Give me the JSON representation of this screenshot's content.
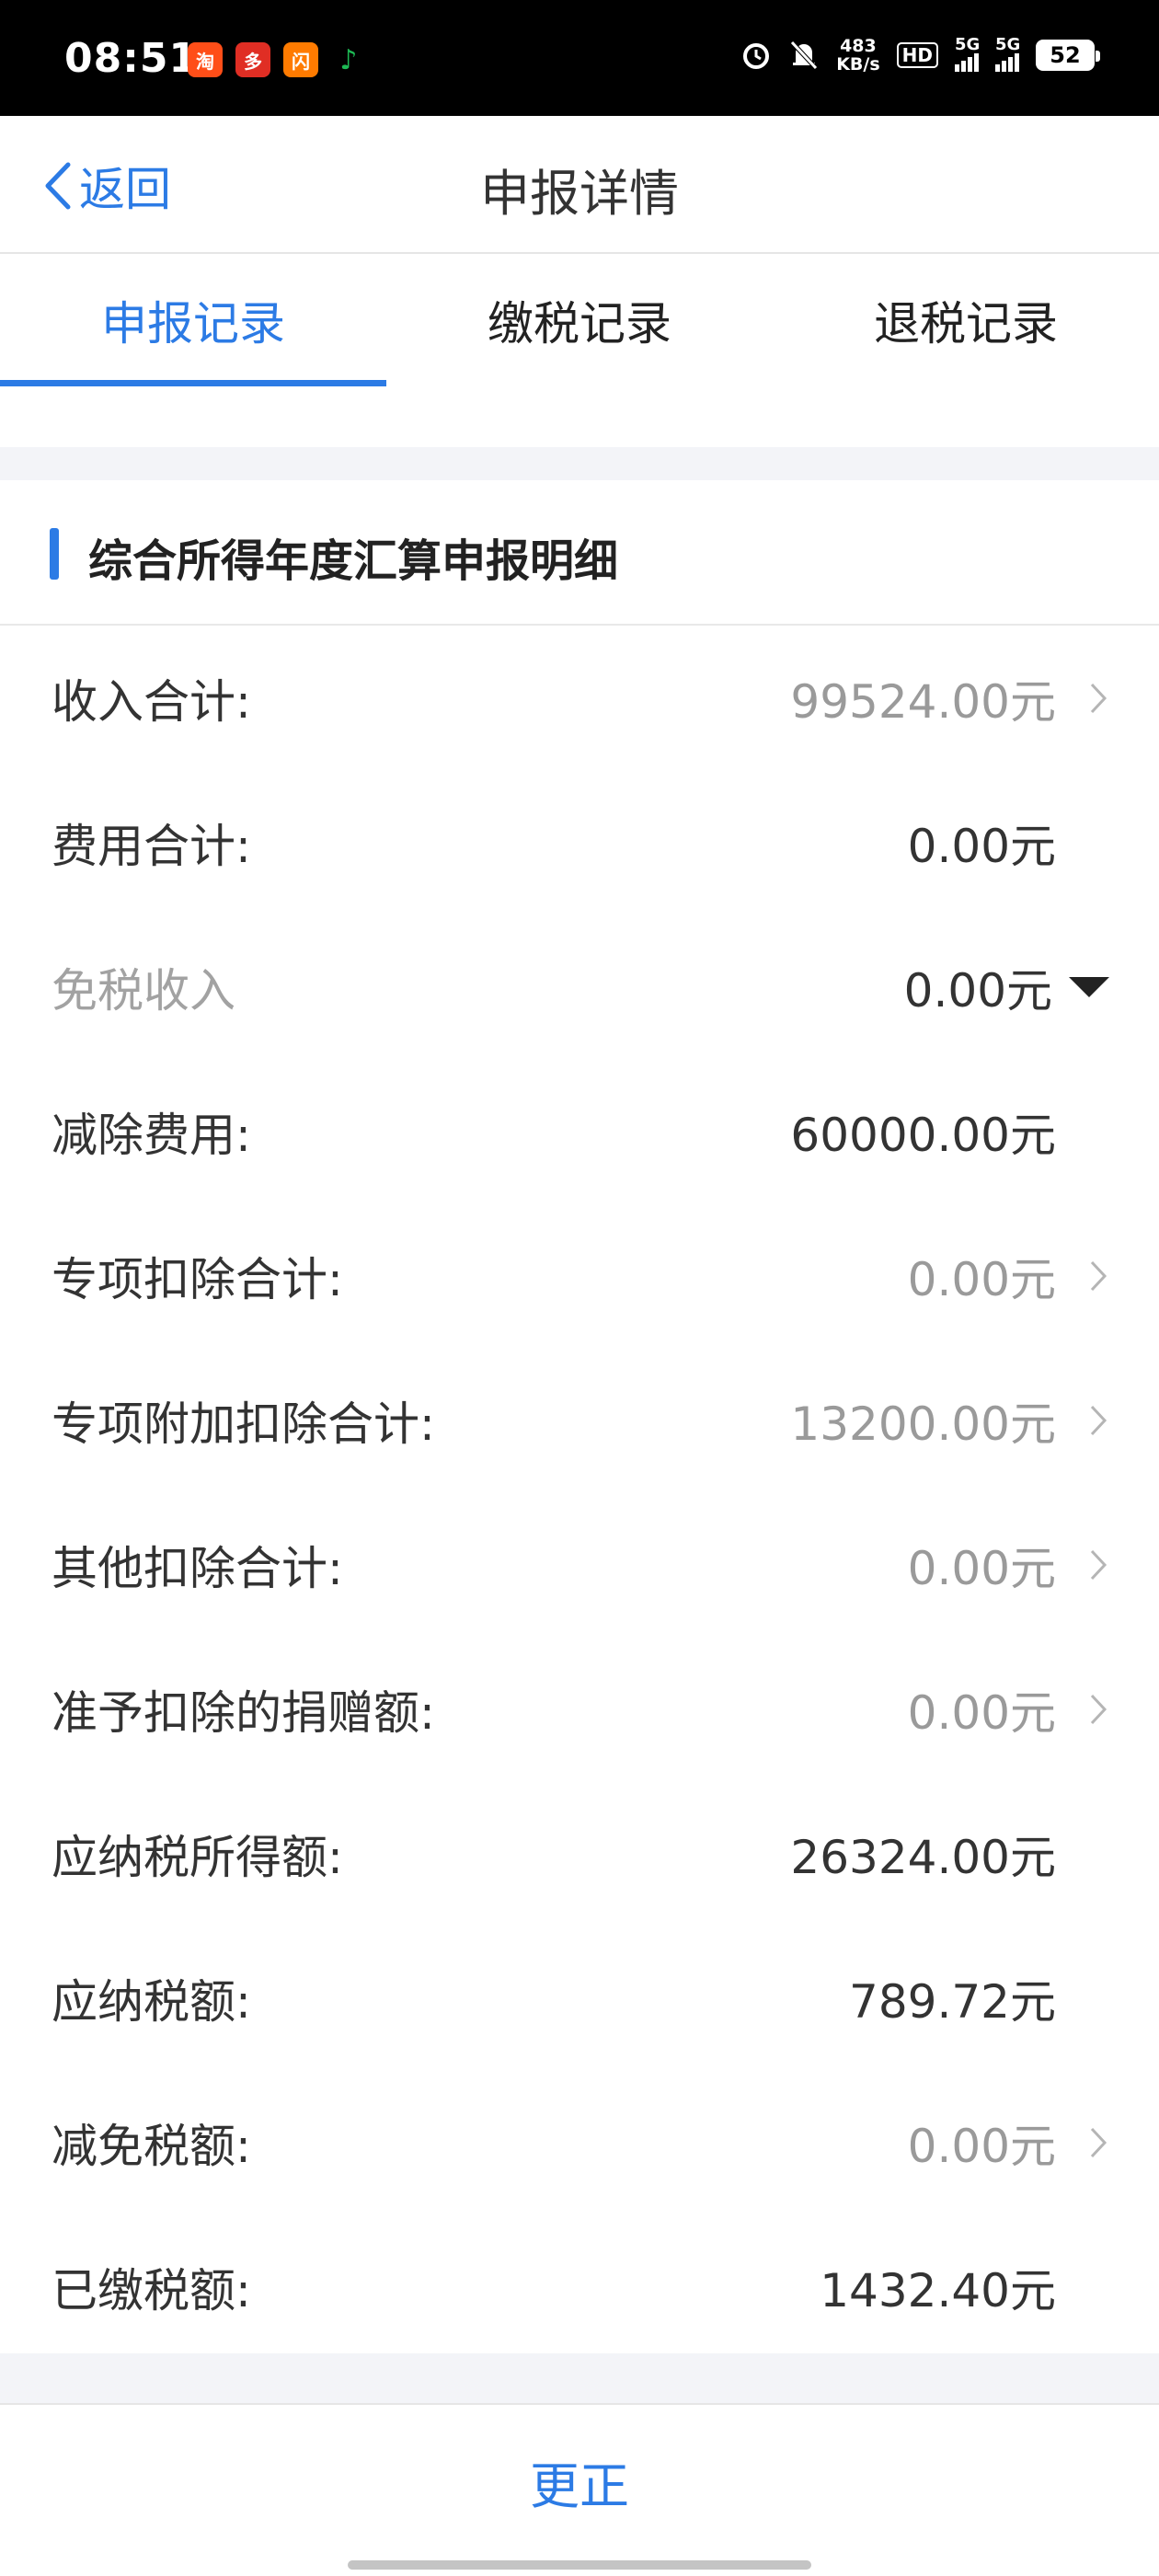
{
  "status_bar": {
    "time": "08:51",
    "apps": [
      {
        "icon": "taobao-app-icon",
        "glyph": "淘",
        "color": "#ff4e18"
      },
      {
        "icon": "pinduoduo-app-icon",
        "glyph": "多",
        "color": "#e02e24"
      },
      {
        "icon": "taobao-flash-app-icon",
        "glyph": "闪",
        "color": "#ff7b00"
      },
      {
        "icon": "music-notification-icon",
        "glyph": "♪",
        "color": "#1db954"
      }
    ],
    "net_speed_value": "483",
    "net_speed_unit": "KB/s",
    "hd_label": "HD",
    "signal_label_1": "5G",
    "signal_label_2": "5G",
    "battery": "52"
  },
  "nav": {
    "back_label": "返回",
    "title": "申报详情"
  },
  "tabs": [
    {
      "label": "申报记录",
      "active": true
    },
    {
      "label": "缴税记录",
      "active": false
    },
    {
      "label": "退税记录",
      "active": false
    }
  ],
  "section": {
    "title": "综合所得年度汇算申报明细"
  },
  "rows": [
    {
      "label": "收入合计:",
      "value": "99524.00元"
    },
    {
      "label": "费用合计:",
      "value": "0.00元"
    },
    {
      "label": "免税收入",
      "value": "0.00元"
    },
    {
      "label": "减除费用:",
      "value": "60000.00元"
    },
    {
      "label": "专项扣除合计:",
      "value": "0.00元"
    },
    {
      "label": "专项附加扣除合计:",
      "value": "13200.00元"
    },
    {
      "label": "其他扣除合计:",
      "value": "0.00元"
    },
    {
      "label": "准予扣除的捐赠额:",
      "value": "0.00元"
    },
    {
      "label": "应纳税所得额:",
      "value": "26324.00元"
    },
    {
      "label": "应纳税额:",
      "value": "789.72元"
    },
    {
      "label": "减免税额:",
      "value": "0.00元"
    },
    {
      "label": "已缴税额:",
      "value": "1432.40元"
    }
  ],
  "bottom": {
    "correct_label": "更正"
  },
  "colors": {
    "accent": "#2c7be5",
    "muted_value": "#9a9a9a"
  }
}
